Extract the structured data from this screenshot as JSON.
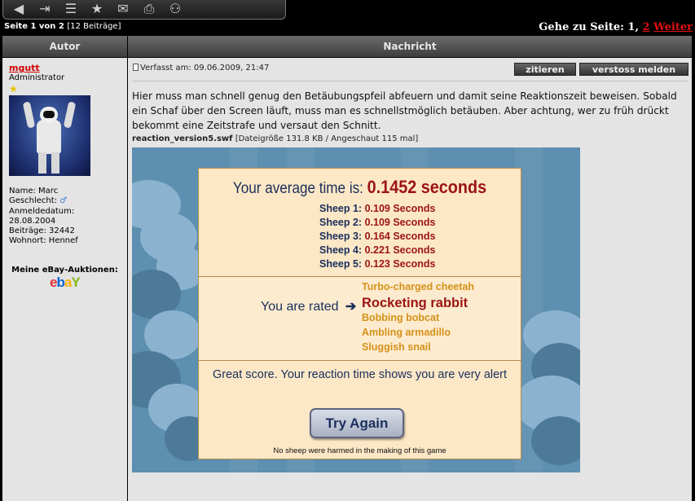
{
  "toolbar": {
    "icons": [
      "back-icon",
      "pages-icon",
      "list-reply-icon",
      "star-icon",
      "envelope-icon",
      "print-icon",
      "binoculars-icon"
    ]
  },
  "pagination": {
    "left_prefix": "Seite 1 von 2",
    "left_count": "[12 Beiträge]",
    "right_prefix": "Gehe zu Seite: 1,",
    "page2": "2",
    "next": "Weiter"
  },
  "table_headers": {
    "author": "Autor",
    "message": "Nachricht"
  },
  "author": {
    "name": "mgutt",
    "rank": "Administrator",
    "name_line": "Name: Marc",
    "gender_line": "Geschlecht:",
    "gender_icon": "male-icon",
    "joined_label": "Anmeldedatum:",
    "joined_date": "28.08.2004",
    "posts_line": "Beiträge: 32442",
    "location_line": "Wohnort: Hennef",
    "ebay_label": "Meine eBay-Auktionen:"
  },
  "post": {
    "meta": "Verfasst am: 09.06.2009, 21:47",
    "quote_button": "zitieren",
    "report_button": "verstoss melden",
    "text": "Hier muss man schnell genug den Betäubungspfeil abfeuern und damit seine Reaktionszeit beweisen. Sobald ein Schaf über den Screen läuft, muss man es schnellstmöglich betäuben. Aber achtung, wer zu früh drückt bekommt eine Zeitstrafe und versaut den Schnitt.",
    "attachment_name": "reaction_version5.swf",
    "attachment_meta": "[Dateigröße 131.8 KB / Angeschaut 115 mal]"
  },
  "game": {
    "avg_label": "Your average time is:",
    "avg_value": "0.1452 seconds",
    "sheep": [
      {
        "label": "Sheep 1:",
        "value": "0.109 Seconds"
      },
      {
        "label": "Sheep 2:",
        "value": "0.109 Seconds"
      },
      {
        "label": "Sheep 3:",
        "value": "0.164 Seconds"
      },
      {
        "label": "Sheep 4:",
        "value": "0.221 Seconds"
      },
      {
        "label": "Sheep 5:",
        "value": "0.123 Seconds"
      }
    ],
    "rated_label": "You are rated",
    "ranks": [
      "Turbo-charged cheetah",
      "Rocketing rabbit",
      "Bobbing bobcat",
      "Ambling armadillo",
      "Sluggish snail"
    ],
    "current_rank_index": 1,
    "score_text": "Great score. Your reaction time shows you are very alert",
    "try_again": "Try Again",
    "footer": "No sheep were harmed in the making of this game"
  },
  "colors": {
    "link_red": "#e01010",
    "header_gray": "#555555",
    "panel_bg": "#fce7c6",
    "game_blue": "#5d8fb0",
    "value_red": "#9b1414",
    "navy": "#1a2f5c",
    "rank_orange": "#d4921a"
  }
}
